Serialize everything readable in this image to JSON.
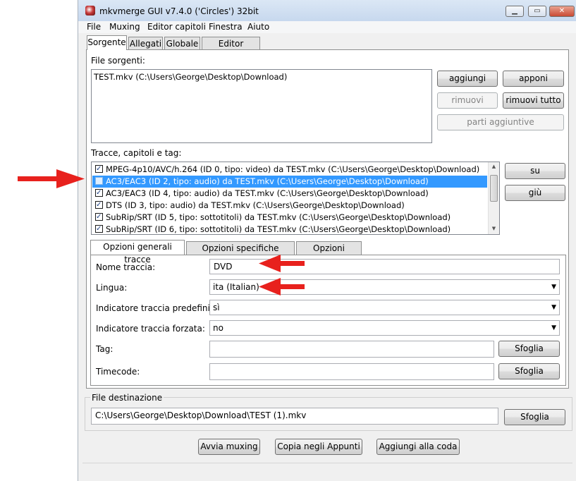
{
  "window": {
    "title": "mkvmerge GUI v7.4.0 ('Circles') 32bit"
  },
  "titlebar": {
    "min": "▁",
    "max": "▭",
    "close": "✕"
  },
  "menu": [
    "File",
    "Muxing",
    "Editor capitoli",
    "Finestra",
    "Aiuto"
  ],
  "main_tabs": [
    "Sorgente",
    "Allegati",
    "Globale",
    "Editor capitoli"
  ],
  "sources": {
    "label": "File sorgenti:",
    "files": [
      "TEST.mkv (C:\\Users\\George\\Desktop\\Download)"
    ],
    "buttons": {
      "add": "aggiungi",
      "append": "apponi",
      "remove": "rimuovi",
      "remove_all": "rimuovi tutto",
      "additional": "parti aggiuntive"
    }
  },
  "tracks": {
    "label": "Tracce, capitoli e tag:",
    "items": [
      {
        "text": "MPEG-4p10/AVC/h.264 (ID 0, tipo: video) da TEST.mkv (C:\\Users\\George\\Desktop\\Download)",
        "checked": true
      },
      {
        "text": "AC3/EAC3 (ID 2, tipo: audio) da TEST.mkv (C:\\Users\\George\\Desktop\\Download)",
        "checked": false,
        "selected": true
      },
      {
        "text": "AC3/EAC3 (ID 4, tipo: audio) da TEST.mkv (C:\\Users\\George\\Desktop\\Download)",
        "checked": true
      },
      {
        "text": "DTS (ID 3, tipo: audio) da TEST.mkv (C:\\Users\\George\\Desktop\\Download)",
        "checked": true
      },
      {
        "text": "SubRip/SRT (ID 5, tipo: sottotitoli) da TEST.mkv (C:\\Users\\George\\Desktop\\Download)",
        "checked": true
      },
      {
        "text": "SubRip/SRT (ID 6, tipo: sottotitoli) da TEST.mkv (C:\\Users\\George\\Desktop\\Download)",
        "checked": true
      }
    ],
    "buttons": {
      "up": "su",
      "down": "giù"
    }
  },
  "options_tabs": [
    "Opzioni generali tracce",
    "Opzioni specifiche formato",
    "Opzioni speciali"
  ],
  "options": {
    "track_name_label": "Nome traccia:",
    "track_name_value": "DVD",
    "language_label": "Lingua:",
    "language_value": "ita (Italian)",
    "default_label": "Indicatore traccia predefinita:",
    "default_value": "sì",
    "forced_label": "Indicatore traccia forzata:",
    "forced_value": "no",
    "tag_label": "Tag:",
    "tag_value": "",
    "timecode_label": "Timecode:",
    "timecode_value": "",
    "browse": "Sfoglia"
  },
  "destination": {
    "label": "File destinazione",
    "value": "C:\\Users\\George\\Desktop\\Download\\TEST (1).mkv",
    "browse": "Sfoglia"
  },
  "actions": {
    "start": "Avvia muxing",
    "copy": "Copia negli Appunti",
    "queue": "Aggiungi alla coda"
  },
  "colors": {
    "selection": "#3399ff",
    "annotation_arrow": "#e8211d",
    "titlebar": "#c7d8ee"
  }
}
